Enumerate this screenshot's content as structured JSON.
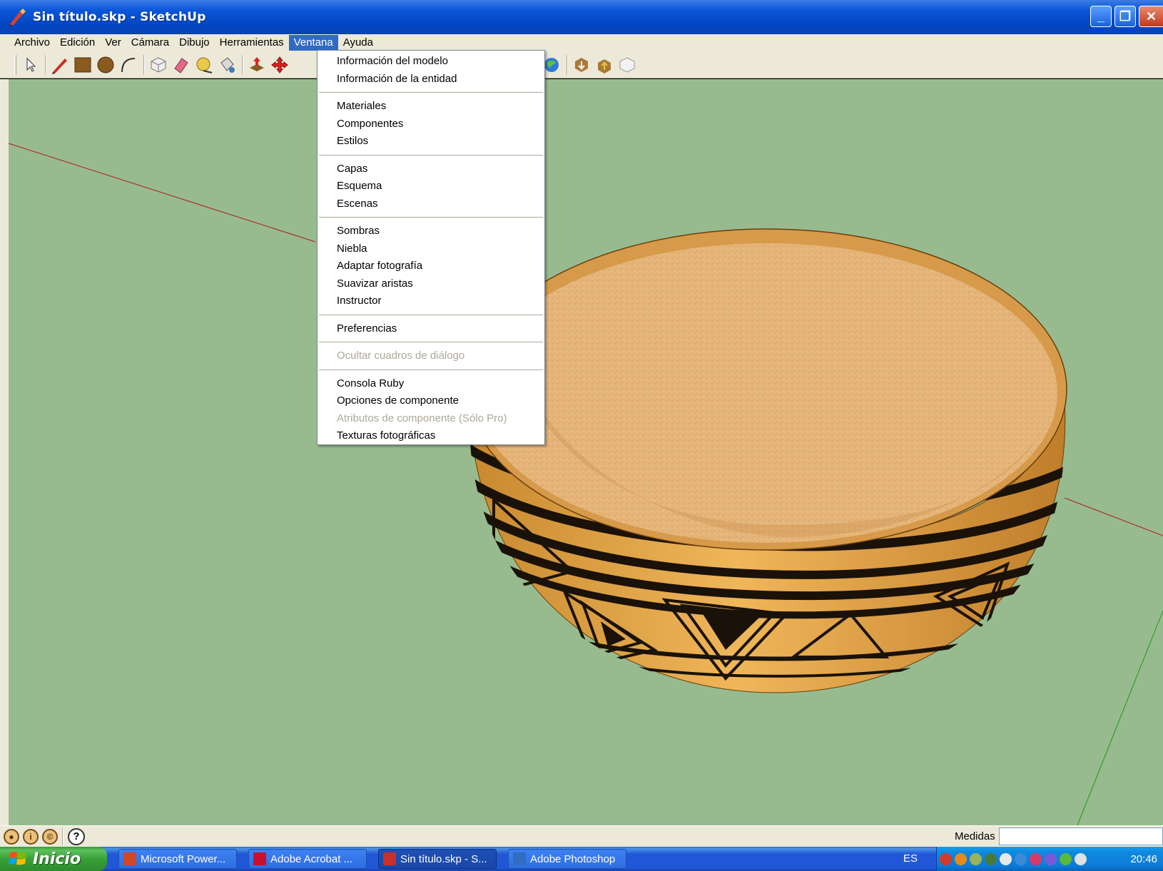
{
  "window": {
    "title": "Sin título.skp - SketchUp",
    "minimize": "_",
    "maximize": "❐",
    "close": "✕"
  },
  "menubar": {
    "items": [
      "Archivo",
      "Edición",
      "Ver",
      "Cámara",
      "Dibujo",
      "Herramientas",
      "Ventana",
      "Ayuda"
    ],
    "active": "Ventana"
  },
  "dropdown": {
    "groups": [
      [
        {
          "label": "Información del modelo",
          "enabled": true
        },
        {
          "label": "Información de la entidad",
          "enabled": true
        }
      ],
      [
        {
          "label": "Materiales",
          "enabled": true
        },
        {
          "label": "Componentes",
          "enabled": true
        },
        {
          "label": "Estilos",
          "enabled": true
        }
      ],
      [
        {
          "label": "Capas",
          "enabled": true
        },
        {
          "label": "Esquema",
          "enabled": true
        },
        {
          "label": "Escenas",
          "enabled": true
        }
      ],
      [
        {
          "label": "Sombras",
          "enabled": true
        },
        {
          "label": "Niebla",
          "enabled": true
        },
        {
          "label": "Adaptar fotografía",
          "enabled": true
        },
        {
          "label": "Suavizar aristas",
          "enabled": true
        },
        {
          "label": "Instructor",
          "enabled": true
        }
      ],
      [
        {
          "label": "Preferencias",
          "enabled": true
        }
      ],
      [
        {
          "label": "Ocultar cuadros de diálogo",
          "enabled": false
        }
      ],
      [
        {
          "label": "Consola Ruby",
          "enabled": true
        },
        {
          "label": "Opciones de componente",
          "enabled": true
        },
        {
          "label": "Atributos de componente (Sólo Pro)",
          "enabled": false
        },
        {
          "label": "Texturas fotográficas",
          "enabled": true
        }
      ]
    ]
  },
  "statusbar": {
    "measure_label": "Medidas",
    "measure_value": "",
    "help": "?"
  },
  "taskbar": {
    "start_label": "Inicio",
    "tasks": [
      {
        "label": "Microsoft Power...",
        "icon_color": "#d24726",
        "active": false
      },
      {
        "label": "Adobe Acrobat ...",
        "icon_color": "#c8102e",
        "active": false
      },
      {
        "label": "Sin título.skp - S...",
        "icon_color": "#c9302c",
        "active": true
      },
      {
        "label": "Adobe Photoshop",
        "icon_color": "#2f6dbf",
        "active": false
      }
    ],
    "language": "ES",
    "clock": "20:46"
  },
  "colors": {
    "viewport_bg": "#97bb8f",
    "menu_highlight": "#316ac5",
    "disabled_text": "#aca899"
  }
}
